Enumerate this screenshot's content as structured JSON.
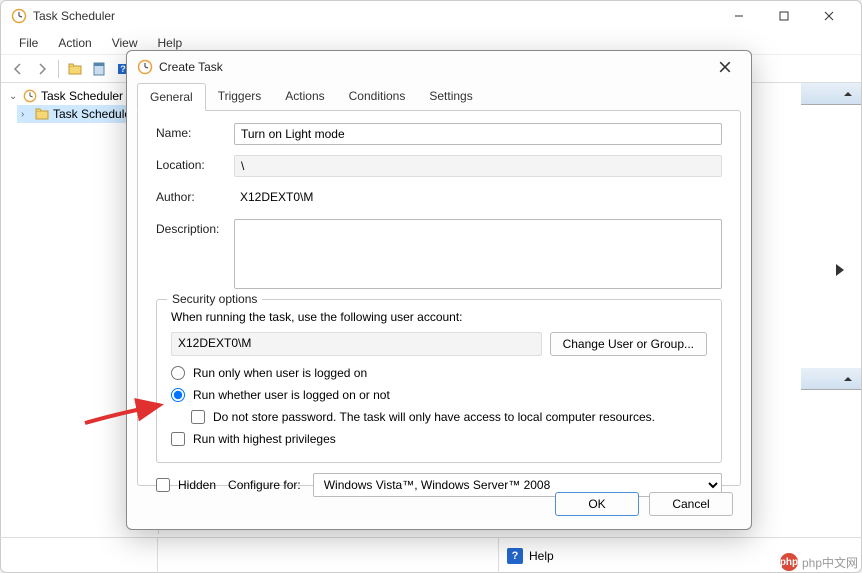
{
  "mainWindow": {
    "title": "Task Scheduler",
    "menu": {
      "file": "File",
      "action": "Action",
      "view": "View",
      "help": "Help"
    }
  },
  "tree": {
    "root": "Task Scheduler (L",
    "child": "Task Schedule"
  },
  "statusbar": {
    "help": "Help"
  },
  "dialog": {
    "title": "Create Task",
    "tabs": {
      "general": "General",
      "triggers": "Triggers",
      "actions": "Actions",
      "conditions": "Conditions",
      "settings": "Settings"
    },
    "labels": {
      "name": "Name:",
      "location": "Location:",
      "author": "Author:",
      "description": "Description:"
    },
    "values": {
      "name": "Turn on Light mode",
      "location": "\\",
      "author": "X12DEXT0\\M",
      "description": ""
    },
    "security": {
      "legend": "Security options",
      "whenRunning": "When running the task, use the following user account:",
      "account": "X12DEXT0\\M",
      "changeUser": "Change User or Group...",
      "runLoggedOn": "Run only when user is logged on",
      "runWhether": "Run whether user is logged on or not",
      "doNotStore": "Do not store password.  The task will only have access to local computer resources.",
      "runHighest": "Run with highest privileges"
    },
    "bottom": {
      "hidden": "Hidden",
      "configureFor": "Configure for:",
      "configValue": "Windows Vista™, Windows Server™ 2008"
    },
    "buttons": {
      "ok": "OK",
      "cancel": "Cancel"
    }
  },
  "watermark": "php中文网"
}
